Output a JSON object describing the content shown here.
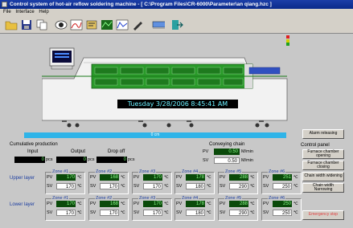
{
  "window": {
    "title": "Control system of hot-air reflow soldering machine - [ C:\\Program Files\\CR-6000\\Parameter\\an qiang.hzc ]"
  },
  "menu": {
    "file": "File",
    "interface": "Interface",
    "help": "Help"
  },
  "clock": "Tuesday 3/28/2006  8:45:41 AM",
  "conveyor_speed_label": "0 cm",
  "buttons": {
    "alarm": "Alarm releasing",
    "control_panel": "Control panel",
    "furnace_open": "Furnace chamber opening",
    "furnace_close": "Furnace chamber closing",
    "chain_widen": "Chain width widening",
    "chain_narrow": "Chain width Narrowing",
    "emergency": "Emergency stop"
  },
  "production": {
    "title": "Cumulative production",
    "input_label": "Input",
    "output_label": "Output",
    "dropoff_label": "Drop off",
    "input": "0",
    "output": "0",
    "dropoff": "0",
    "unit": "pcs"
  },
  "chain": {
    "title": "Conveying chain",
    "pv_label": "PV",
    "sv_label": "SV",
    "pv": "0.50",
    "sv": "0.50",
    "unit": "M/min"
  },
  "labels": {
    "upper": "Upper layer",
    "lower": "Lower layer",
    "pv": "PV",
    "sv": "SV",
    "deg": "℃"
  },
  "zones": {
    "upper": [
      {
        "name": "Zone #1",
        "pv": "170",
        "sv": "170"
      },
      {
        "name": "Zone #2",
        "pv": "168",
        "sv": "170"
      },
      {
        "name": "Zone #3",
        "pv": "170",
        "sv": "170"
      },
      {
        "name": "Zone #4",
        "pv": "178",
        "sv": "180"
      },
      {
        "name": "Zone #5",
        "pv": "288",
        "sv": "290"
      },
      {
        "name": "Zone #6",
        "pv": "251",
        "sv": "250"
      }
    ],
    "lower": [
      {
        "name": "Zone #1",
        "pv": "170",
        "sv": "170"
      },
      {
        "name": "Zone #2",
        "pv": "168",
        "sv": "170"
      },
      {
        "name": "Zone #3",
        "pv": "170",
        "sv": "170"
      },
      {
        "name": "Zone #4",
        "pv": "178",
        "sv": "180"
      },
      {
        "name": "Zone #5",
        "pv": "288",
        "sv": "290"
      },
      {
        "name": "Zone #6",
        "pv": "250",
        "sv": "250"
      }
    ]
  },
  "colors": {
    "title_bar": "#0a2a8a",
    "pv_bg": "#0a4a0a",
    "pv_text": "#8cff8c",
    "clock_text": "#6cf0ff",
    "conveyor": "#2fb4e8",
    "emergency": "#e04040"
  }
}
